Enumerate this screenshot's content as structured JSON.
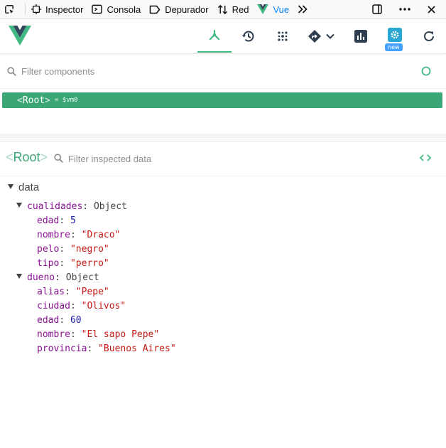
{
  "devtools_tabs": {
    "inspector": "Inspector",
    "console": "Consola",
    "debugger": "Depurador",
    "network": "Red",
    "vue": "Vue"
  },
  "vue_toolbar": {
    "new_badge": "new"
  },
  "component_filter": {
    "placeholder": "Filter components"
  },
  "tree_root": {
    "open": "<",
    "name": "Root",
    "close": ">",
    "vm_alias": "= $vm0"
  },
  "inspector": {
    "component_open": "<",
    "component_name": "Root",
    "component_close": ">",
    "filter_placeholder": "Filter inspected data"
  },
  "data": {
    "section_title": "data",
    "cualidades": {
      "key": "cualidades",
      "type": "Object",
      "fields": [
        {
          "key": "edad",
          "value": "5",
          "kind": "num"
        },
        {
          "key": "nombre",
          "value": "\"Draco\"",
          "kind": "str"
        },
        {
          "key": "pelo",
          "value": "\"negro\"",
          "kind": "str"
        },
        {
          "key": "tipo",
          "value": "\"perro\"",
          "kind": "str"
        }
      ]
    },
    "dueno": {
      "key": "dueno",
      "type": "Object",
      "fields": [
        {
          "key": "alias",
          "value": "\"Pepe\"",
          "kind": "str"
        },
        {
          "key": "ciudad",
          "value": "\"Olivos\"",
          "kind": "str"
        },
        {
          "key": "edad",
          "value": "60",
          "kind": "num"
        },
        {
          "key": "nombre",
          "value": "\"El sapo Pepe\"",
          "kind": "str"
        },
        {
          "key": "provincia",
          "value": "\"Buenos Aires\"",
          "kind": "str"
        }
      ]
    }
  },
  "colors": {
    "vue_green": "#42b983",
    "selected_row": "#3ba776",
    "firefox_blue": "#0a84ff",
    "string": "#c41a16",
    "number": "#1a1aa6",
    "key": "#881391"
  }
}
